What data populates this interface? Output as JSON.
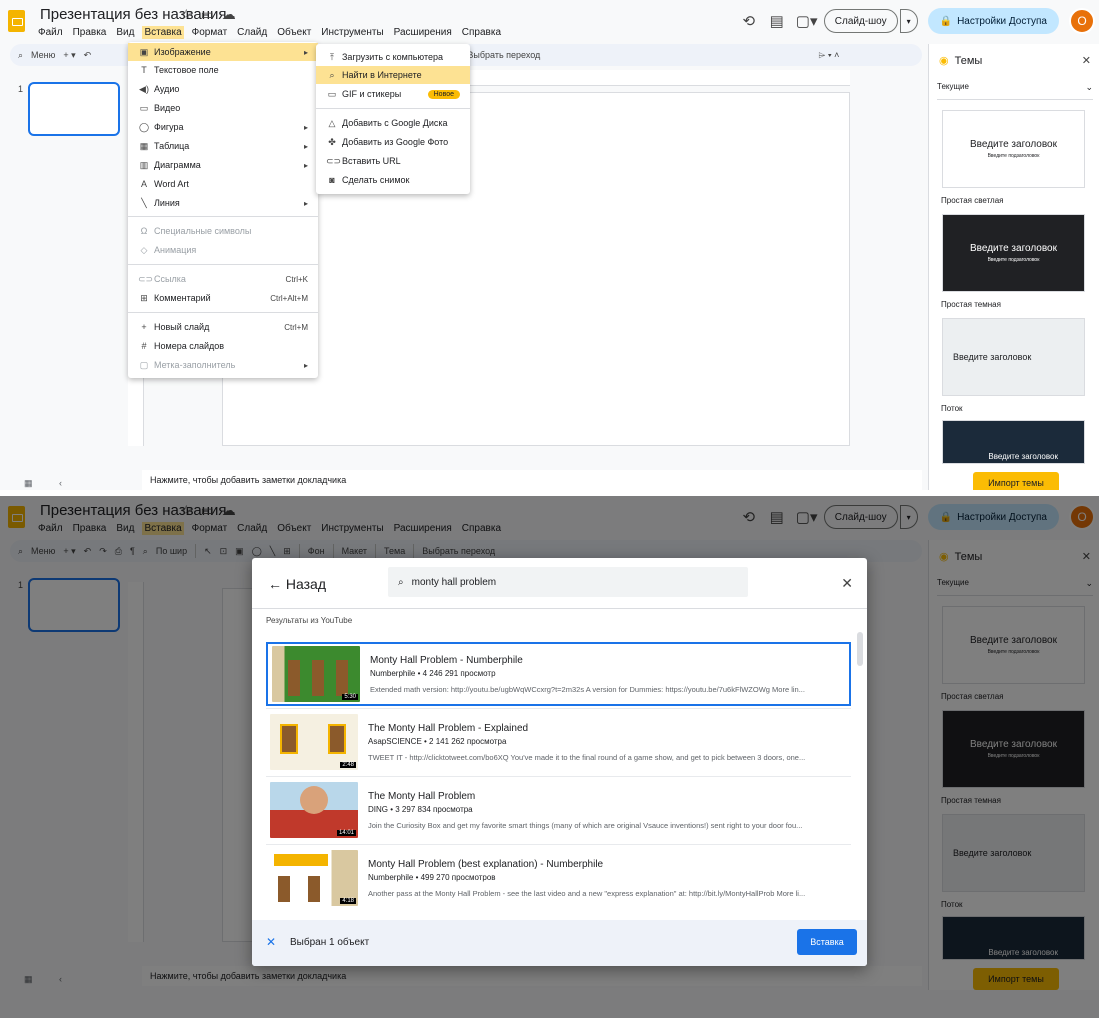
{
  "app": {
    "doc_title": "Презентация без названия",
    "menus": [
      "Файл",
      "Правка",
      "Вид",
      "Вставка",
      "Формат",
      "Слайд",
      "Объект",
      "Инструменты",
      "Расширения",
      "Справка"
    ],
    "menu_active": "Вставка",
    "slideshow_label": "Слайд-шоу",
    "access_label": "Настройки Доступа",
    "avatar_letter": "O",
    "slide_number": "1",
    "notes_placeholder": "Нажмите, чтобы добавить заметки докладчика"
  },
  "toolbar": {
    "menu_label": "Меню",
    "zoom_label": "По шир",
    "background_label": "Фон",
    "layout_label": "Макет",
    "theme_label": "Тема",
    "transition_label": "Выбрать переход"
  },
  "insert_menu": {
    "items": [
      {
        "label": "Изображение",
        "icon": "image-icon"
      },
      {
        "label": "Текстовое поле",
        "icon": "textbox-icon"
      },
      {
        "label": "Аудио",
        "icon": "audio-icon"
      },
      {
        "label": "Видео",
        "icon": "video-icon"
      },
      {
        "label": "Фигура",
        "icon": "shape-icon"
      },
      {
        "label": "Таблица",
        "icon": "table-icon"
      },
      {
        "label": "Диаграмма",
        "icon": "chart-icon"
      },
      {
        "label": "Word Art",
        "icon": "wordart-icon"
      },
      {
        "label": "Линия",
        "icon": "line-icon"
      },
      {
        "label": "Специальные символы",
        "icon": "omega-icon"
      },
      {
        "label": "Анимация",
        "icon": "animation-icon"
      },
      {
        "label": "Ссылка",
        "shortcut": "Ctrl+K",
        "icon": "link-icon"
      },
      {
        "label": "Комментарий",
        "shortcut": "Ctrl+Alt+M",
        "icon": "comment-icon"
      },
      {
        "label": "Новый слайд",
        "shortcut": "Ctrl+M",
        "icon": "plus-icon"
      },
      {
        "label": "Номера слайдов",
        "icon": "hash-icon"
      },
      {
        "label": "Метка-заполнитель",
        "icon": "placeholder-icon"
      }
    ]
  },
  "image_submenu": {
    "items": [
      {
        "label": "Загрузить с компьютера"
      },
      {
        "label": "Найти в Интернете"
      },
      {
        "label": "GIF и стикеры",
        "badge": "Новое"
      },
      {
        "label": "Добавить с Google Диска"
      },
      {
        "label": "Добавить из Google Фото"
      },
      {
        "label": "Вставить URL"
      },
      {
        "label": "Сделать снимок"
      }
    ]
  },
  "themes": {
    "title": "Темы",
    "current_label": "Текущие",
    "cards": [
      {
        "title": "Введите заголовок",
        "subtitle": "Введите подзаголовок",
        "name": "Простая светлая"
      },
      {
        "title": "Введите заголовок",
        "subtitle": "Введите подзаголовок",
        "name": "Простая темная"
      },
      {
        "title": "Введите заголовок",
        "subtitle": "",
        "name": "Поток"
      },
      {
        "title": "Введите заголовок",
        "subtitle": "",
        "name": ""
      }
    ],
    "import_label": "Импорт темы"
  },
  "dialog": {
    "back_label": "Назад",
    "search_value": "monty hall problem",
    "section_label": "Результаты из YouTube",
    "results": [
      {
        "title": "Monty Hall Problem - Numberphile",
        "meta": "Numberphile • 4 246 291 просмотр",
        "desc": "Extended math version: http://youtu.be/ugbWqWCcxrg?t=2m32s A version for Dummies: https://youtu.be/7u6kFlWZOWg More lin...",
        "duration": "5:30"
      },
      {
        "title": "The Monty Hall Problem - Explained",
        "meta": "AsapSCIENCE • 2 141 262 просмотра",
        "desc": "TWEET IT - http://clicktotweet.com/bo6XQ You've made it to the final round of a game show, and get to pick between 3 doors, one...",
        "duration": "2:48"
      },
      {
        "title": "The Monty Hall Problem",
        "meta": "DING • 3 297 834 просмотра",
        "desc": "Join the Curiosity Box and get my favorite smart things (many of which are original Vsauce inventions!) sent right to your door fou...",
        "duration": "14:01"
      },
      {
        "title": "Monty Hall Problem (best explanation) - Numberphile",
        "meta": "Numberphile • 499 270 просмотров",
        "desc": "Another pass at the Monty Hall Problem - see the last video and a new \"express explanation\" at: http://bit.ly/MontyHallProb More li...",
        "duration": "4:18"
      }
    ],
    "selected_label": "Выбран 1 объект",
    "insert_label": "Вставка"
  }
}
